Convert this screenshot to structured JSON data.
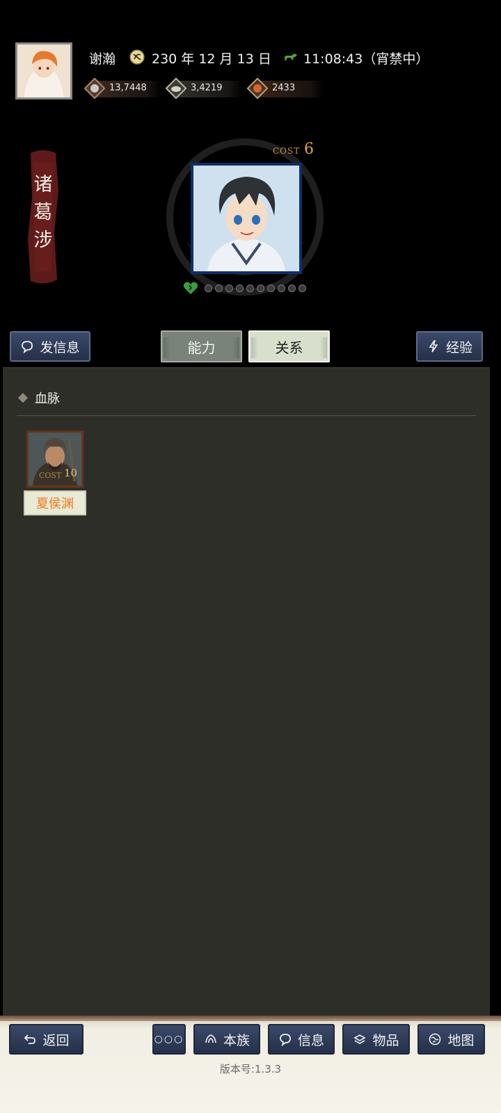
{
  "header": {
    "player_name": "谢瀚",
    "date": "230 年 12 月 13 日",
    "time": "11:08:43（宵禁中）"
  },
  "resources": [
    {
      "name": "silver-coin",
      "value": "13,7448"
    },
    {
      "name": "grain",
      "value": "3,4219"
    },
    {
      "name": "copper",
      "value": "2433"
    }
  ],
  "general": {
    "name": "诸\n葛\n涉",
    "cost_label": "COST",
    "cost_value": "6",
    "loyalty_dots_filled": 0,
    "loyalty_dots_total": 10
  },
  "actions": {
    "send_message": "发信息",
    "tab_ability": "能力",
    "tab_relation": "关系",
    "experience": "经验"
  },
  "panel": {
    "section_title": "血脉",
    "relatives": [
      {
        "name": "夏侯渊",
        "cost_label": "COST",
        "cost_value": "10"
      }
    ]
  },
  "bottom_nav": {
    "back": "返回",
    "more": "○○○",
    "clan": "本族",
    "info": "信息",
    "items": "物品",
    "map": "地图"
  },
  "version": "版本号:1.3.3",
  "colors": {
    "button_blue": "#2f3c58",
    "panel_bg": "#2e2e29",
    "relative_name": "#f07a1e",
    "cost_gold": "#e3a54a"
  }
}
